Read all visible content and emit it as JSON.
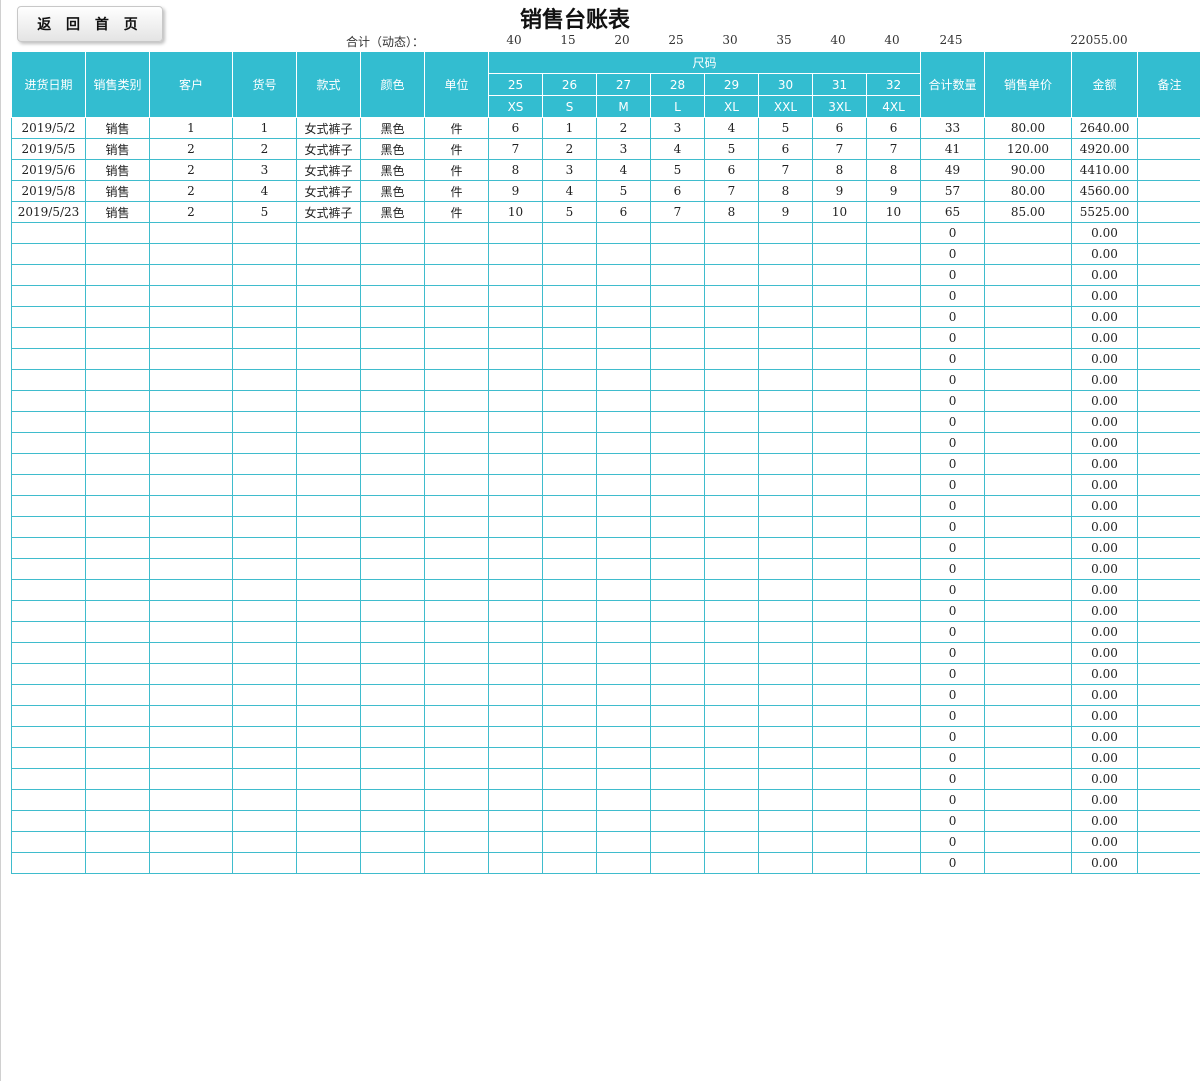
{
  "nav": {
    "home_button": "返 回 首 页"
  },
  "title": "销售台账表",
  "totals": {
    "label": "合计（动态）：",
    "sizes": [
      "40",
      "15",
      "20",
      "25",
      "30",
      "35",
      "40",
      "40"
    ],
    "qty": "245",
    "amount": "22055.00"
  },
  "headers": {
    "date": "进货日期",
    "category": "销售类别",
    "customer": "客户",
    "item_no": "货号",
    "style": "款式",
    "color": "颜色",
    "unit": "单位",
    "size_group": "尺码",
    "total_qty": "合计数量",
    "unit_price": "销售单价",
    "amount": "金额",
    "remark": "备注"
  },
  "sizes": [
    "25",
    "26",
    "27",
    "28",
    "29",
    "30",
    "31",
    "32"
  ],
  "size_codes": [
    "XS",
    "S",
    "M",
    "L",
    "XL",
    "XXL",
    "3XL",
    "4XL"
  ],
  "rows": [
    {
      "date": "2019/5/2",
      "category": "销售",
      "customer": "1",
      "item_no": "1",
      "style": "女式裤子",
      "color": "黑色",
      "unit": "件",
      "sizes": [
        "6",
        "1",
        "2",
        "3",
        "4",
        "5",
        "6",
        "6"
      ],
      "qty": "33",
      "price": "80.00",
      "amount": "2640.00",
      "remark": ""
    },
    {
      "date": "2019/5/5",
      "category": "销售",
      "customer": "2",
      "item_no": "2",
      "style": "女式裤子",
      "color": "黑色",
      "unit": "件",
      "sizes": [
        "7",
        "2",
        "3",
        "4",
        "5",
        "6",
        "7",
        "7"
      ],
      "qty": "41",
      "price": "120.00",
      "amount": "4920.00",
      "remark": ""
    },
    {
      "date": "2019/5/6",
      "category": "销售",
      "customer": "2",
      "item_no": "3",
      "style": "女式裤子",
      "color": "黑色",
      "unit": "件",
      "sizes": [
        "8",
        "3",
        "4",
        "5",
        "6",
        "7",
        "8",
        "8"
      ],
      "qty": "49",
      "price": "90.00",
      "amount": "4410.00",
      "remark": ""
    },
    {
      "date": "2019/5/8",
      "category": "销售",
      "customer": "2",
      "item_no": "4",
      "style": "女式裤子",
      "color": "黑色",
      "unit": "件",
      "sizes": [
        "9",
        "4",
        "5",
        "6",
        "7",
        "8",
        "9",
        "9"
      ],
      "qty": "57",
      "price": "80.00",
      "amount": "4560.00",
      "remark": ""
    },
    {
      "date": "2019/5/23",
      "category": "销售",
      "customer": "2",
      "item_no": "5",
      "style": "女式裤子",
      "color": "黑色",
      "unit": "件",
      "sizes": [
        "10",
        "5",
        "6",
        "7",
        "8",
        "9",
        "10",
        "10"
      ],
      "qty": "65",
      "price": "85.00",
      "amount": "5525.00",
      "remark": ""
    }
  ],
  "empty_row": {
    "qty": "0",
    "amount": "0.00",
    "count": 31
  }
}
